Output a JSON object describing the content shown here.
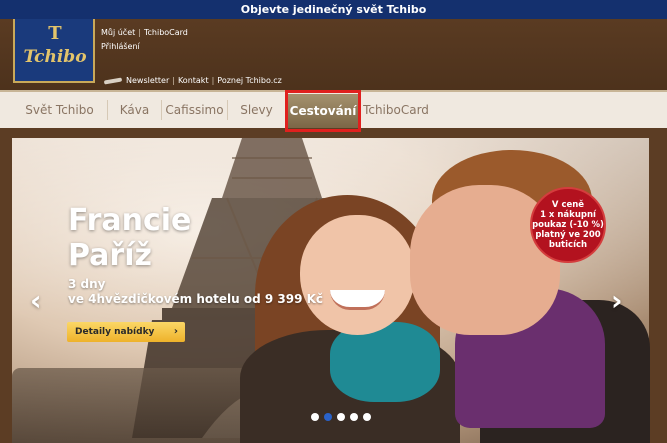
{
  "topbar": {
    "text": "Objevte jedinečný svět Tchibo"
  },
  "logo": {
    "mark": "T",
    "text": "Tchibo"
  },
  "header": {
    "my_account": "Můj účet",
    "tchibocard": "TchiboCard",
    "login": "Přihlášení",
    "newsletter": "Newsletter",
    "contact": "Kontakt",
    "poznej": "Poznej Tchibo.cz",
    "separator": "|"
  },
  "nav": {
    "items": [
      {
        "label": "Svět Tchibo"
      },
      {
        "label": "Káva"
      },
      {
        "label": "Cafissimo"
      },
      {
        "label": "Slevy"
      },
      {
        "label": "Cestování"
      },
      {
        "label": "TchiboCard"
      }
    ],
    "active_index": 4
  },
  "hero": {
    "title_line1": "Francie",
    "title_line2": "Paříž",
    "sub_line1": "3 dny",
    "sub_line2": "ve 4hvězdičkovém hotelu od 9 399 Kč",
    "cta": "Detaily nabídky",
    "cta_chev": "›",
    "badge": [
      "V ceně",
      "1 x nákupní",
      "poukaz (-10 %)",
      "platný ve 200",
      "buticích"
    ],
    "arrow_left": "‹",
    "arrow_right": "›",
    "slides": 5,
    "active_slide": 1
  },
  "colors": {
    "topbar": "#14306e",
    "logo_bg": "#1a3a7c",
    "logo_gold": "#e3c46b",
    "nav_bg": "#f0e9e0",
    "active_tab": "#7b6646",
    "highlight": "#e0201e",
    "cta": "#eeb22a",
    "badge": "#b3121f"
  }
}
